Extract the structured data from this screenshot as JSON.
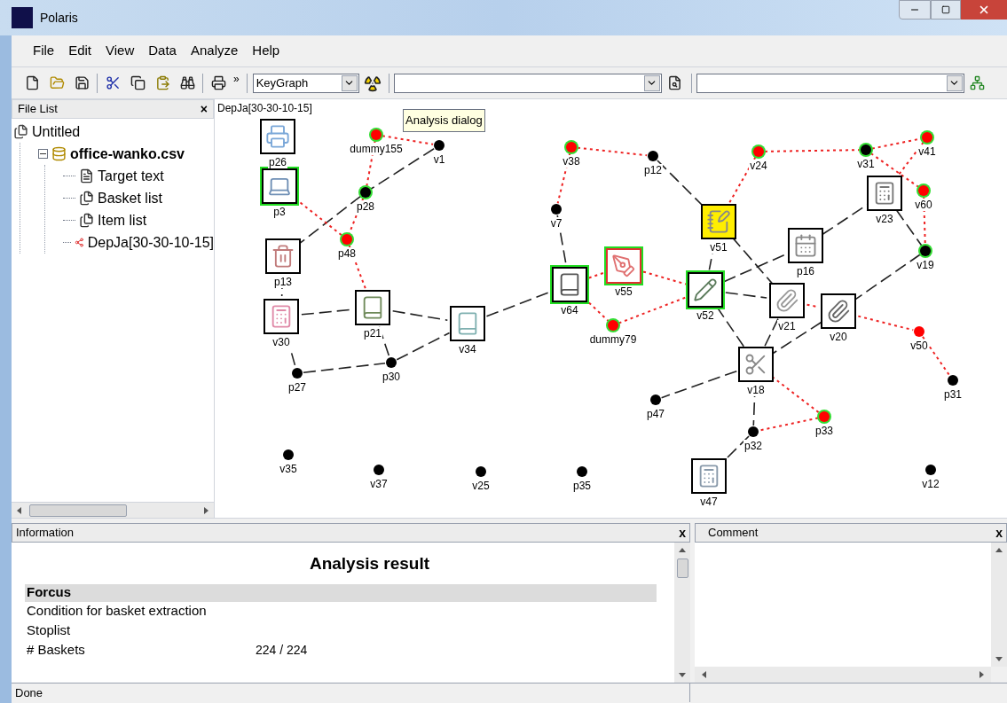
{
  "window": {
    "title": "Polaris"
  },
  "menu": [
    "File",
    "Edit",
    "View",
    "Data",
    "Analyze",
    "Help"
  ],
  "toolbar": {
    "more": "»",
    "view_select": {
      "value": "KeyGraph"
    }
  },
  "file_list": {
    "title": "File List",
    "close": "×",
    "tree": [
      {
        "label": "Untitled",
        "kind": "project",
        "children": [
          {
            "label": "office-wanko.csv",
            "kind": "data",
            "expanded": true,
            "children": [
              {
                "label": "Target text",
                "kind": "text"
              },
              {
                "label": "Basket list",
                "kind": "list"
              },
              {
                "label": "Item list",
                "kind": "list"
              },
              {
                "label": "DepJa[30-30-10-15]",
                "kind": "graph"
              }
            ]
          }
        ]
      }
    ]
  },
  "graph": {
    "title": "DepJa[30-30-10-15]",
    "tooltip": "Analysis dialog",
    "nodes": [
      {
        "label": "p26",
        "kind": "picture",
        "color": "#ffffff",
        "highlighted": false,
        "flagged": false
      },
      {
        "label": "dummy155",
        "kind": "dot",
        "color": "#ff0000",
        "ringed": true
      },
      {
        "label": "v1",
        "kind": "dot",
        "color": "#000000",
        "ringed": false
      },
      {
        "label": "p3",
        "kind": "picture",
        "color": "#ffffff",
        "highlighted": true,
        "flagged": false
      },
      {
        "label": "p28",
        "kind": "dot",
        "color": "#000000",
        "ringed": true
      },
      {
        "label": "p48",
        "kind": "dot",
        "color": "#ff0000",
        "ringed": true
      },
      {
        "label": "p13",
        "kind": "picture",
        "color": "#ffffff",
        "highlighted": false,
        "flagged": false
      },
      {
        "label": "v30",
        "kind": "picture",
        "color": "#ffffff",
        "highlighted": false,
        "flagged": false
      },
      {
        "label": "p21",
        "kind": "picture",
        "color": "#ffffff",
        "highlighted": false,
        "flagged": false
      },
      {
        "label": "v34",
        "kind": "picture",
        "color": "#ffffff",
        "highlighted": false,
        "flagged": false
      },
      {
        "label": "p27",
        "kind": "dot",
        "color": "#000000",
        "ringed": false
      },
      {
        "label": "p30",
        "kind": "dot",
        "color": "#000000",
        "ringed": false
      },
      {
        "label": "v64",
        "kind": "picture",
        "color": "#ffffff",
        "highlighted": true,
        "flagged": false
      },
      {
        "label": "v55",
        "kind": "picture",
        "color": "#ffffff",
        "highlighted": true,
        "flagged": true
      },
      {
        "label": "dummy79",
        "kind": "dot",
        "color": "#ff0000",
        "ringed": true
      },
      {
        "label": "v38",
        "kind": "dot",
        "color": "#ff0000",
        "ringed": true
      },
      {
        "label": "p12",
        "kind": "dot",
        "color": "#000000",
        "ringed": false
      },
      {
        "label": "v7",
        "kind": "dot",
        "color": "#000000",
        "ringed": false
      },
      {
        "label": "v51",
        "kind": "picture",
        "color": "#ffee00",
        "highlighted": false,
        "flagged": false
      },
      {
        "label": "v24",
        "kind": "dot",
        "color": "#ff0000",
        "ringed": true
      },
      {
        "label": "v31",
        "kind": "dot",
        "color": "#000000",
        "ringed": true
      },
      {
        "label": "v41",
        "kind": "dot",
        "color": "#ff0000",
        "ringed": true
      },
      {
        "label": "v60",
        "kind": "dot",
        "color": "#ff0000",
        "ringed": true
      },
      {
        "label": "v23",
        "kind": "picture",
        "color": "#ffffff",
        "highlighted": false,
        "flagged": false
      },
      {
        "label": "v19",
        "kind": "dot",
        "color": "#000000",
        "ringed": true
      },
      {
        "label": "p16",
        "kind": "picture",
        "color": "#ffffff",
        "highlighted": false,
        "flagged": false
      },
      {
        "label": "v52",
        "kind": "picture",
        "color": "#ffffff",
        "highlighted": true,
        "flagged": false
      },
      {
        "label": "v21",
        "kind": "picture",
        "color": "#ffffff",
        "highlighted": false,
        "flagged": false
      },
      {
        "label": "v20",
        "kind": "picture",
        "color": "#ffffff",
        "highlighted": false,
        "flagged": false
      },
      {
        "label": "v50",
        "kind": "dot",
        "color": "#ff0000",
        "ringed": false
      },
      {
        "label": "p31",
        "kind": "dot",
        "color": "#000000",
        "ringed": false
      },
      {
        "label": "v18",
        "kind": "picture",
        "color": "#ffffff",
        "highlighted": false,
        "flagged": false
      },
      {
        "label": "p47",
        "kind": "dot",
        "color": "#000000",
        "ringed": false
      },
      {
        "label": "p32",
        "kind": "dot",
        "color": "#000000",
        "ringed": false
      },
      {
        "label": "p33",
        "kind": "dot",
        "color": "#ff0000",
        "ringed": true
      },
      {
        "label": "v47",
        "kind": "picture",
        "color": "#ffffff",
        "highlighted": false,
        "flagged": false
      },
      {
        "label": "v35",
        "kind": "dot",
        "color": "#000000",
        "ringed": false
      },
      {
        "label": "v37",
        "kind": "dot",
        "color": "#000000",
        "ringed": false
      },
      {
        "label": "v25",
        "kind": "dot",
        "color": "#000000",
        "ringed": false
      },
      {
        "label": "p35",
        "kind": "dot",
        "color": "#000000",
        "ringed": false
      },
      {
        "label": "v12",
        "kind": "dot",
        "color": "#000000",
        "ringed": false
      }
    ]
  },
  "information": {
    "title": "Information",
    "close": "x",
    "heading": "Analysis result",
    "section": "Forcus",
    "rows": [
      {
        "label": "Condition for basket extraction"
      },
      {
        "label": "Stoplist"
      },
      {
        "label": "# Baskets",
        "value": "224 / 224"
      }
    ]
  },
  "comment": {
    "title": "Comment",
    "close": "x"
  },
  "status_bar": {
    "text": "Done"
  }
}
